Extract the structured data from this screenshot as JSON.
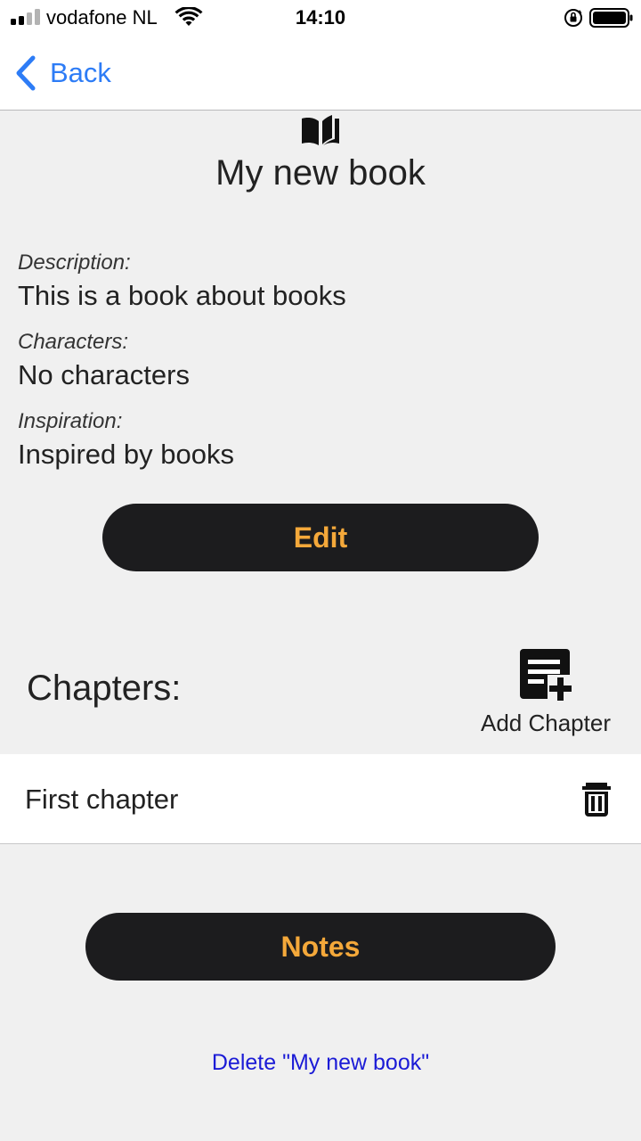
{
  "status_bar": {
    "carrier": "vodafone NL",
    "time": "14:10",
    "signal_bars_filled": 2,
    "signal_bars_total": 4
  },
  "nav": {
    "back_label": "Back"
  },
  "book": {
    "icon": "open-book-icon",
    "title": "My new book",
    "fields": [
      {
        "label": "Description:",
        "value": "This is a book about books"
      },
      {
        "label": "Characters:",
        "value": "No characters"
      },
      {
        "label": "Inspiration:",
        "value": "Inspired by books"
      }
    ],
    "edit_label": "Edit"
  },
  "chapters": {
    "heading": "Chapters:",
    "add_label": "Add Chapter",
    "add_icon": "note-add-icon",
    "items": [
      {
        "title": "First chapter",
        "delete_icon": "trash-icon"
      }
    ]
  },
  "notes_label": "Notes",
  "delete_label": "Delete \"My new book\"",
  "colors": {
    "accent": "#f4a83a",
    "link_blue": "#2d7cf6",
    "delete_link": "#1b1bd6",
    "pill_bg": "#1c1c1e",
    "page_bg": "#f0f0f0"
  }
}
